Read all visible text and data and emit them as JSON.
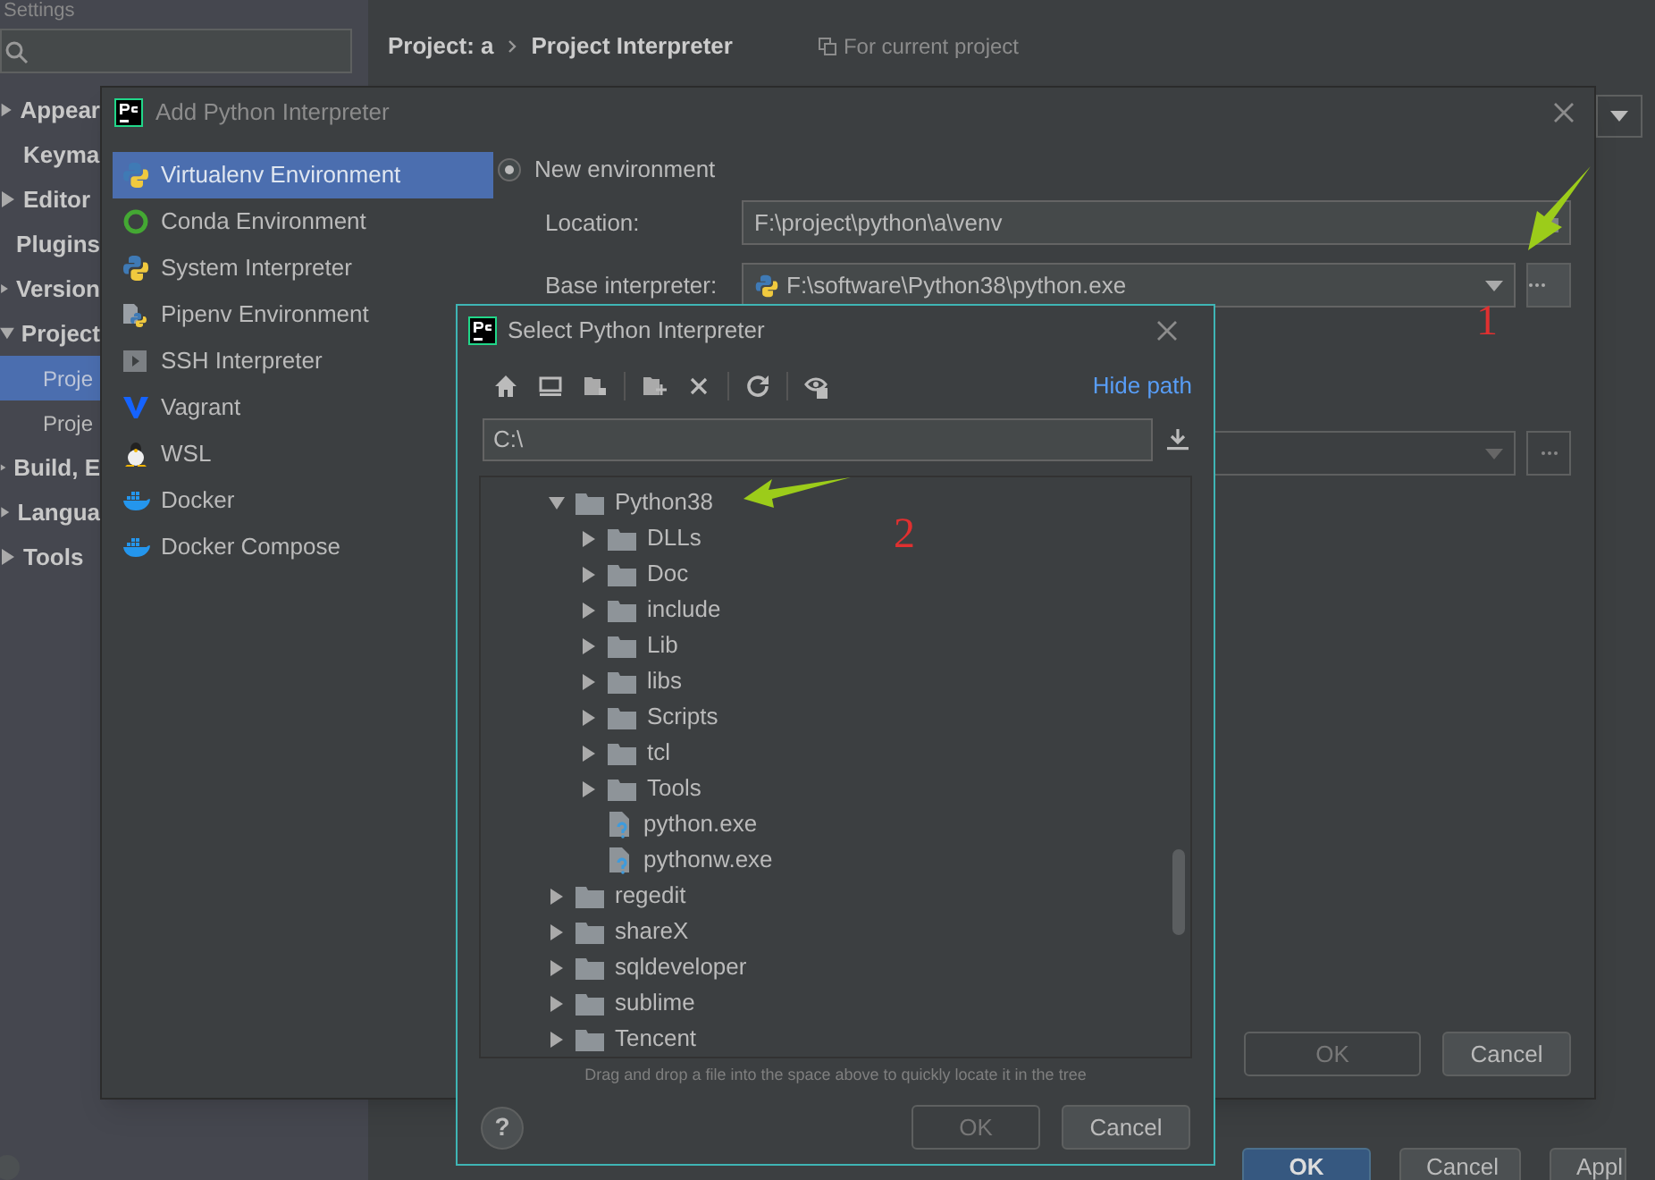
{
  "settings": {
    "title": "Settings",
    "sidebar": [
      {
        "label": "Appear",
        "kind": "group",
        "expanded": false,
        "selected": false
      },
      {
        "label": "Keyma",
        "kind": "page",
        "selected": false
      },
      {
        "label": "Editor",
        "kind": "group",
        "expanded": false,
        "selected": false
      },
      {
        "label": "Plugins",
        "kind": "page",
        "selected": false
      },
      {
        "label": "Version",
        "kind": "group",
        "expanded": false,
        "selected": false
      },
      {
        "label": "Project",
        "kind": "group",
        "expanded": true,
        "selected": false,
        "children": [
          {
            "label": "Proje",
            "selected": true
          },
          {
            "label": "Proje",
            "selected": false
          }
        ]
      },
      {
        "label": "Build, E",
        "kind": "group",
        "expanded": false,
        "selected": false
      },
      {
        "label": "Langua",
        "kind": "group",
        "expanded": false,
        "selected": false
      },
      {
        "label": "Tools",
        "kind": "group",
        "expanded": false,
        "selected": false
      }
    ],
    "breadcrumb": [
      "Project: a",
      "Project Interpreter"
    ],
    "scope_note": "For current project",
    "buttons": [
      {
        "label": "OK",
        "kind": "primary"
      },
      {
        "label": "Cancel",
        "kind": "normal"
      },
      {
        "label": "Appl",
        "kind": "normal"
      }
    ]
  },
  "add_dialog": {
    "title": "Add Python Interpreter",
    "environments": [
      {
        "label": "Virtualenv Environment",
        "kind": "python",
        "selected": true
      },
      {
        "label": "Conda Environment",
        "kind": "conda",
        "selected": false
      },
      {
        "label": "System Interpreter",
        "kind": "python",
        "selected": false
      },
      {
        "label": "Pipenv Environment",
        "kind": "pipenv",
        "selected": false
      },
      {
        "label": "SSH Interpreter",
        "kind": "ssh",
        "selected": false
      },
      {
        "label": "Vagrant",
        "kind": "vagrant",
        "selected": false
      },
      {
        "label": "WSL",
        "kind": "wsl",
        "selected": false
      },
      {
        "label": "Docker",
        "kind": "docker",
        "selected": false
      },
      {
        "label": "Docker Compose",
        "kind": "docker",
        "selected": false
      }
    ],
    "new_environment": {
      "label": "New environment",
      "selected": true
    },
    "location": {
      "label": "Location:",
      "value": "F:\\project\\python\\a\\venv"
    },
    "base_interpreter": {
      "label": "Base interpreter:",
      "value": "F:\\software\\Python38\\python.exe"
    },
    "buttons": [
      {
        "label": "OK",
        "disabled": true
      },
      {
        "label": "Cancel",
        "disabled": false
      }
    ]
  },
  "select_dialog": {
    "title": "Select Python Interpreter",
    "hide_path": "Hide path",
    "path": "C:\\",
    "tree": [
      {
        "label": "Python38",
        "kind": "folder",
        "expanded": true,
        "children": [
          {
            "label": "DLLs",
            "kind": "folder",
            "expanded": false
          },
          {
            "label": "Doc",
            "kind": "folder",
            "expanded": false
          },
          {
            "label": "include",
            "kind": "folder",
            "expanded": false
          },
          {
            "label": "Lib",
            "kind": "folder",
            "expanded": false
          },
          {
            "label": "libs",
            "kind": "folder",
            "expanded": false
          },
          {
            "label": "Scripts",
            "kind": "folder",
            "expanded": false
          },
          {
            "label": "tcl",
            "kind": "folder",
            "expanded": false
          },
          {
            "label": "Tools",
            "kind": "folder",
            "expanded": false
          },
          {
            "label": "python.exe",
            "kind": "file"
          },
          {
            "label": "pythonw.exe",
            "kind": "file"
          }
        ]
      },
      {
        "label": "regedit",
        "kind": "folder",
        "expanded": false
      },
      {
        "label": "shareX",
        "kind": "folder",
        "expanded": false
      },
      {
        "label": "sqldeveloper",
        "kind": "folder",
        "expanded": false
      },
      {
        "label": "sublime",
        "kind": "folder",
        "expanded": false
      },
      {
        "label": "Tencent",
        "kind": "folder",
        "expanded": false
      }
    ],
    "hint": "Drag and drop a file into the space above to quickly locate it in the tree",
    "help": "?",
    "buttons": [
      {
        "label": "OK",
        "disabled": true
      },
      {
        "label": "Cancel",
        "disabled": false
      }
    ]
  },
  "annotations": [
    {
      "text": "1"
    },
    {
      "text": "2"
    }
  ]
}
